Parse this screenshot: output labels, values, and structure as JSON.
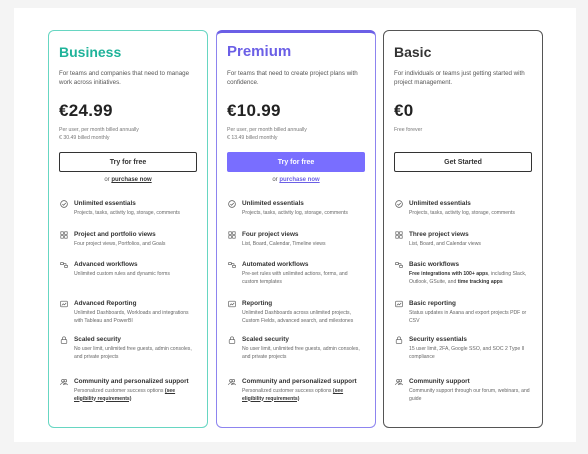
{
  "plans": [
    {
      "name": "Business",
      "description": "For teams and companies that need to manage work across initiatives.",
      "price": "€24.99",
      "price_note_1": "Per user, per month billed annually",
      "price_note_2": "€ 30.49 billed monthly",
      "cta": "Try for free",
      "purchase_prefix": "or",
      "purchase_link": "purchase now",
      "features": [
        {
          "icon": "check-circle-icon",
          "title": "Unlimited essentials",
          "desc": "Projects, tasks, activity log, storage, comments"
        },
        {
          "icon": "grid-icon",
          "title": "Project and portfolio views",
          "desc": "Four project views, Portfolios, and Goals"
        },
        {
          "icon": "workflow-icon",
          "title": "Advanced workflows",
          "desc": "Unlimited custom rules and dynamic forms"
        },
        {
          "icon": "chart-icon",
          "title": "Advanced Reporting",
          "desc": "Unlimited Dashboards, Workloads and integrations with Tableau and PowerBI"
        },
        {
          "icon": "lock-icon",
          "title": "Scaled security",
          "desc": "No user limit, unlimited free guests, admin consoles, and private projects"
        },
        {
          "icon": "people-icon",
          "title": "Community and personalized support",
          "desc": "Personalized customer success options",
          "desc_link": "(see eligibility requirements)"
        }
      ]
    },
    {
      "name": "Premium",
      "description": "For teams that need to create project plans with confidence.",
      "price": "€10.99",
      "price_note_1": "Per user, per month billed annually",
      "price_note_2": "€ 13.49 billed monthly",
      "cta": "Try for free",
      "purchase_prefix": "or",
      "purchase_link": "purchase now",
      "features": [
        {
          "icon": "check-circle-icon",
          "title": "Unlimited essentials",
          "desc": "Projects, tasks, activity log, storage, comments"
        },
        {
          "icon": "grid-icon",
          "title": "Four project views",
          "desc": "List, Board, Calendar, Timeline views"
        },
        {
          "icon": "workflow-icon",
          "title": "Automated workflows",
          "desc": "Pre-set rules with unlimited actions, forms, and custom templates"
        },
        {
          "icon": "chart-icon",
          "title": "Reporting",
          "desc": "Unlimited Dashboards across unlimited projects, Custom Fields, advanced search, and milestones"
        },
        {
          "icon": "lock-icon",
          "title": "Scaled security",
          "desc": "No user limit, unlimited free guests, admin consoles, and private projects"
        },
        {
          "icon": "people-icon",
          "title": "Community and personalized support",
          "desc": "Personalized customer success options",
          "desc_link": "(see eligibility requirements)"
        }
      ]
    },
    {
      "name": "Basic",
      "description": "For individuals or teams just getting started with project management.",
      "price": "€0",
      "price_note_1": "Free forever",
      "price_note_2": "",
      "cta": "Get Started",
      "features": [
        {
          "icon": "check-circle-icon",
          "title": "Unlimited essentials",
          "desc": "Projects, tasks, activity log, storage, comments"
        },
        {
          "icon": "grid-icon",
          "title": "Three project views",
          "desc": "List, Board, and Calendar views"
        },
        {
          "icon": "workflow-icon",
          "title": "Basic workflows",
          "desc_bold_1": "Free integrations with 100+ apps",
          "desc_mid": ", including Slack, Outlook, GSuite, and ",
          "desc_bold_2": "time tracking apps"
        },
        {
          "icon": "chart-icon",
          "title": "Basic reporting",
          "desc": "Status updates in Asana and export projects PDF or CSV"
        },
        {
          "icon": "lock-icon",
          "title": "Security essentials",
          "desc": "15 user limit, 2FA, Google SSO, and SOC 2 Type II compliance"
        },
        {
          "icon": "people-icon",
          "title": "Community support",
          "desc": "Community support through our forum, webinars, and guide"
        }
      ]
    }
  ]
}
